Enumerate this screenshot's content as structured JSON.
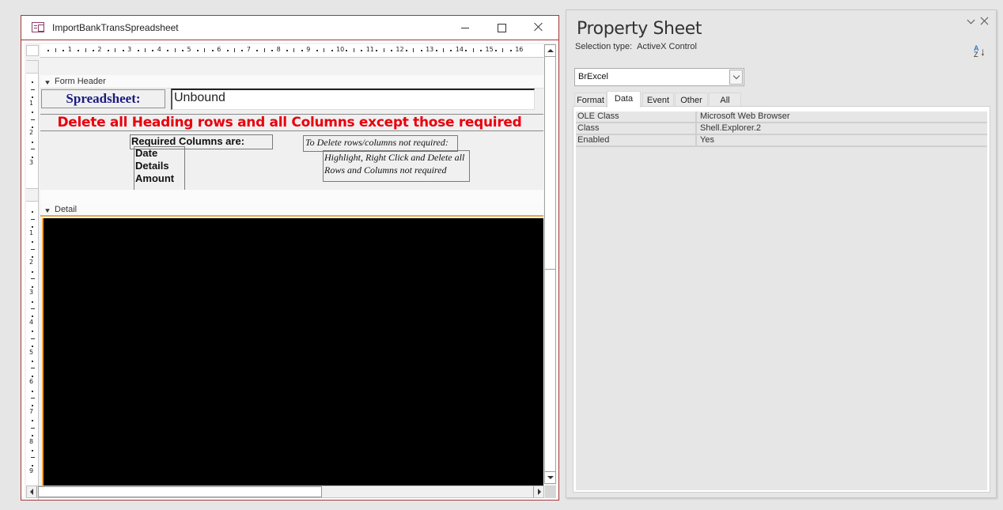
{
  "form_window": {
    "title": "ImportBankTransSpreadsheet",
    "ruler_h": [
      "1",
      "2",
      "3",
      "4",
      "5",
      "6",
      "7",
      "8",
      "9",
      "10",
      "11",
      "12",
      "13",
      "14",
      "15",
      "16"
    ],
    "ruler_v_header": [
      "1",
      "2",
      "3"
    ],
    "ruler_v_detail": [
      "1",
      "2",
      "3",
      "4",
      "5",
      "6",
      "7",
      "8",
      "9"
    ],
    "sections": {
      "form_header": "Form Header",
      "detail": "Detail"
    },
    "controls": {
      "spreadsheet_label": "Spreadsheet:",
      "unbound_textbox": "Unbound",
      "warning_label": "Delete all Heading rows and all Columns except those required",
      "required_label": "Required Columns are:",
      "required_columns": [
        "Date",
        "Details",
        "Amount"
      ],
      "to_delete_label": "To Delete rows/columns not required:",
      "instructions": [
        "Highlight, Right Click and Delete all",
        "Rows and Columns not required"
      ]
    },
    "colors": {
      "window_border": "#a4373a",
      "warning_text": "#e8000d",
      "spreadsheet_label": "#1a1a80",
      "selection_accent": "#f4a340"
    }
  },
  "property_sheet": {
    "title": "Property Sheet",
    "selection_type_label": "Selection type:",
    "selection_type_value": "ActiveX Control",
    "object_selector_value": "BrExcel",
    "tabs": [
      {
        "label": "Format",
        "active": false
      },
      {
        "label": "Data",
        "active": true
      },
      {
        "label": "Event",
        "active": false
      },
      {
        "label": "Other",
        "active": false
      },
      {
        "label": "All",
        "active": false
      }
    ],
    "properties": [
      {
        "name": "OLE Class",
        "value": "Microsoft Web Browser"
      },
      {
        "name": "Class",
        "value": "Shell.Explorer.2"
      },
      {
        "name": "Enabled",
        "value": "Yes"
      }
    ],
    "sort_icon": {
      "top": "A",
      "bottom": "Z",
      "arrow": "↓"
    }
  }
}
